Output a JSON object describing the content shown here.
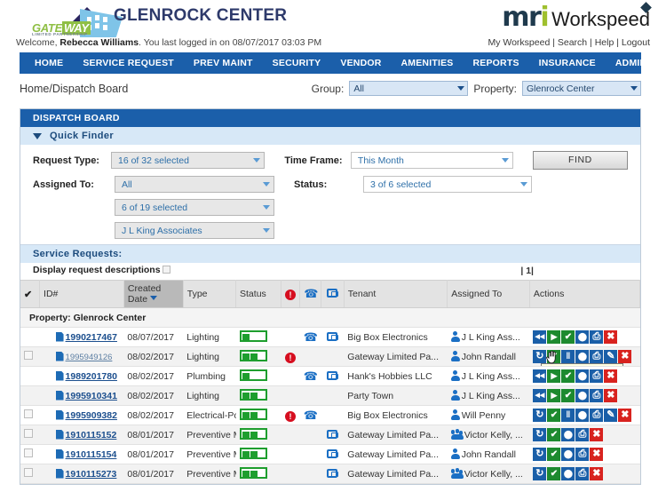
{
  "brand": {
    "logo_primary": "gateway-limited-partnership-logo",
    "logo_word_1": "GATE",
    "logo_word_2": "WAY",
    "logo_subtitle": "LIMITED PARTNERSHIP",
    "site_title": "GLENROCK CENTER",
    "product_mr": "mr",
    "product_i": "i",
    "product_name": "Workspeed"
  },
  "welcome": {
    "prefix": "Welcome,",
    "user": "Rebecca Williams",
    "suffix": ". You last logged in on 08/07/2017 03:03 PM",
    "links": [
      "My Workspeed",
      "Search",
      "Help",
      "Logout"
    ]
  },
  "nav": {
    "items": [
      "HOME",
      "SERVICE REQUEST",
      "PREV MAINT",
      "SECURITY",
      "VENDOR",
      "AMENITIES",
      "REPORTS",
      "INSURANCE",
      "ADMIN"
    ]
  },
  "subhead": {
    "breadcrumb": "Home/Dispatch Board",
    "group_label": "Group:",
    "group_value": "All",
    "property_label": "Property:",
    "property_value": "Glenrock Center"
  },
  "panel": {
    "title": "DISPATCH BOARD",
    "quick_finder": "Quick Finder",
    "filters": {
      "request_type_label": "Request Type:",
      "request_type_value": "16 of 32 selected",
      "time_frame_label": "Time Frame:",
      "time_frame_value": "This Month",
      "find_button": "FIND",
      "assigned_to_label": "Assigned To:",
      "assigned_to_value": "All",
      "assigned_to_value_2": "6 of 19 selected",
      "assigned_to_value_3": "J L King Associates",
      "status_label": "Status:",
      "status_value": "3 of 6 selected"
    },
    "service_requests_label": "Service Requests:",
    "display_descriptions_label": "Display request descriptions",
    "pager": "| 1|"
  },
  "table": {
    "columns": [
      "ID#",
      "Created Date",
      "Type",
      "Status",
      "priority-icon",
      "phone-icon",
      "chat-icon",
      "Tenant",
      "Assigned To",
      "Actions"
    ],
    "sorted_column": "Created Date",
    "property_group": "Property: Glenrock Center",
    "rows": [
      {
        "checkbox": false,
        "id": "1990217467",
        "id_dim": false,
        "created": "08/07/2017",
        "type": "Lighting",
        "status_segments": 1,
        "priority": false,
        "phone": true,
        "chat": true,
        "tenant": "Big Box Electronics",
        "assignee": "J L King Ass...",
        "assignee_icon": "person-icon",
        "actions": [
          "rewind",
          "play",
          "check",
          "comment",
          "print",
          "delete"
        ]
      },
      {
        "checkbox": true,
        "id": "1995949126",
        "id_dim": true,
        "created": "08/02/2017",
        "type": "Lighting",
        "status_segments": 2,
        "priority": true,
        "phone": false,
        "chat": false,
        "tenant": "Gateway Limited Pa...",
        "assignee": "John Randall",
        "assignee_icon": "person-icon",
        "actions": [
          "refresh",
          "check",
          "pause",
          "comment",
          "print",
          "edit",
          "delete"
        ],
        "tooltip": "Complete on behalf"
      },
      {
        "checkbox": false,
        "id": "1989201780",
        "id_dim": false,
        "created": "08/02/2017",
        "type": "Plumbing",
        "status_segments": 1,
        "priority": false,
        "phone": true,
        "chat": true,
        "tenant": "Hank's Hobbies LLC",
        "assignee": "J L King Ass...",
        "assignee_icon": "person-icon",
        "actions": [
          "rewind",
          "play",
          "check",
          "comment",
          "print",
          "delete"
        ]
      },
      {
        "checkbox": false,
        "id": "1995910341",
        "id_dim": false,
        "created": "08/02/2017",
        "type": "Lighting",
        "status_segments": 2,
        "priority": false,
        "phone": false,
        "chat": false,
        "tenant": "Party Town",
        "assignee": "J L King Ass...",
        "assignee_icon": "person-icon",
        "actions": [
          "rewind",
          "play",
          "check",
          "comment",
          "print",
          "delete"
        ]
      },
      {
        "checkbox": true,
        "id": "1995909382",
        "id_dim": false,
        "created": "08/02/2017",
        "type": "Electrical-Power",
        "status_segments": 2,
        "priority": true,
        "phone": true,
        "chat": false,
        "tenant": "Big Box Electronics",
        "assignee": "Will Penny",
        "assignee_icon": "person-icon",
        "actions": [
          "refresh",
          "check",
          "pause",
          "comment",
          "print",
          "edit",
          "delete"
        ]
      },
      {
        "checkbox": true,
        "id": "1910115152",
        "id_dim": false,
        "created": "08/01/2017",
        "type": "Preventive Mai...",
        "status_segments": 2,
        "priority": false,
        "phone": false,
        "chat": true,
        "tenant": "Gateway Limited Pa...",
        "assignee": "Victor Kelly, ...",
        "assignee_icon": "group-icon",
        "actions": [
          "refresh",
          "check",
          "comment",
          "print",
          "delete"
        ]
      },
      {
        "checkbox": true,
        "id": "1910115154",
        "id_dim": false,
        "created": "08/01/2017",
        "type": "Preventive Mai...",
        "status_segments": 2,
        "priority": false,
        "phone": false,
        "chat": true,
        "tenant": "Gateway Limited Pa...",
        "assignee": "John Randall",
        "assignee_icon": "person-icon",
        "actions": [
          "refresh",
          "check",
          "comment",
          "print",
          "delete"
        ]
      },
      {
        "checkbox": true,
        "id": "1910115273",
        "id_dim": false,
        "created": "08/01/2017",
        "type": "Preventive Mai...",
        "status_segments": 2,
        "priority": false,
        "phone": false,
        "chat": true,
        "tenant": "Gateway Limited Pa...",
        "assignee": "Victor Kelly, ...",
        "assignee_icon": "group-icon",
        "actions": [
          "refresh",
          "check",
          "comment",
          "print",
          "delete"
        ]
      }
    ]
  },
  "colors": {
    "nav_blue": "#1b5faa",
    "panel_header_blue": "#1b5faa",
    "band_light_blue": "#d7e8f7",
    "action_blue": "#1a5fa8",
    "action_green": "#1d8a2f",
    "action_red": "#d8231f",
    "status_green": "#1e9e2e",
    "priority_red": "#d60e1f",
    "link_blue": "#1c4f8e",
    "title_navy": "#2e3a6b",
    "mri_green": "#9fc02e"
  }
}
